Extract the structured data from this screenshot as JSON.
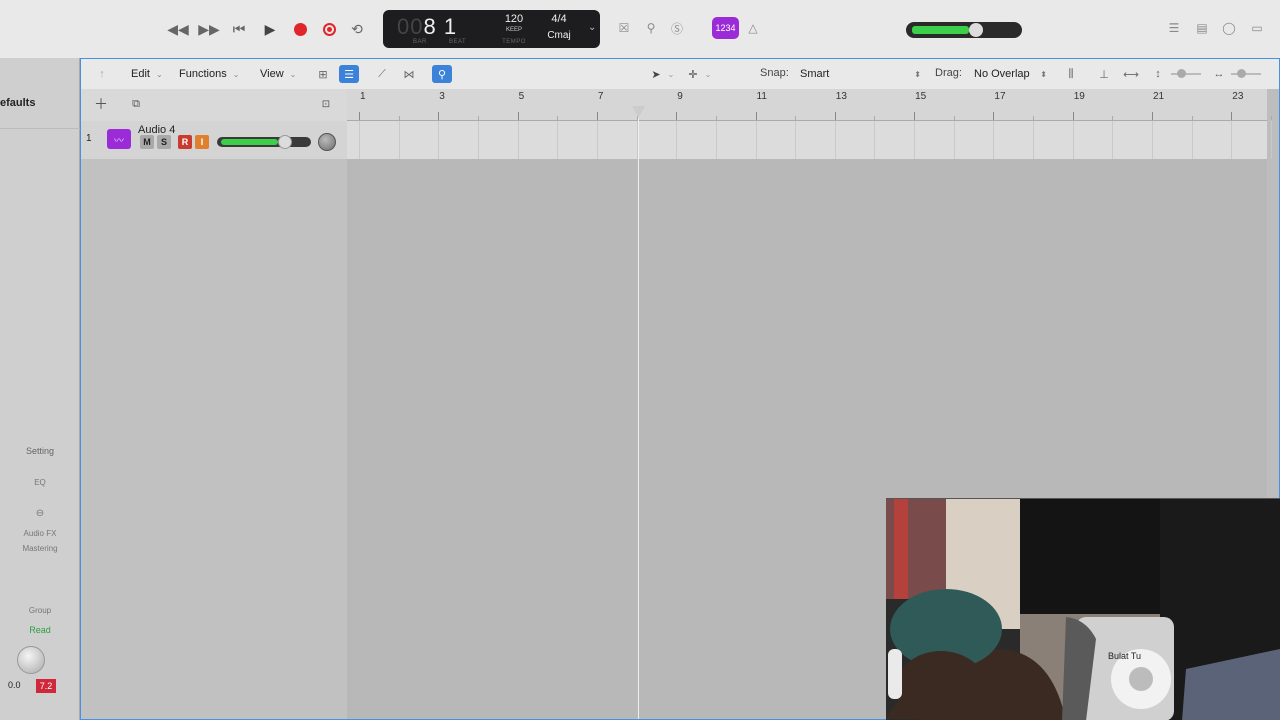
{
  "control_bar": {
    "lcd": {
      "bar_dim": "00",
      "bar": "8",
      "beat": "1",
      "bar_caption": "BAR",
      "beat_caption": "BEAT",
      "tempo": "120",
      "tempo_mode": "KEEP",
      "tempo_caption": "TEMPO",
      "time_signature": "4/4",
      "key": "Cmaj"
    },
    "count_in_badge": "1234",
    "master_volume_level": 0.55
  },
  "inspector": {
    "region_label_fragment": "efaults",
    "setting_button": "Setting",
    "eq_button": "EQ",
    "audio_fx": "Audio FX",
    "fx_slot": "Mastering",
    "group": "Group",
    "automation": "Read",
    "value_left": "0.0",
    "value_right": "7.2"
  },
  "toolbar": {
    "edit_menu": "Edit",
    "functions_menu": "Functions",
    "view_menu": "View",
    "snap_label": "Snap:",
    "snap_value": "Smart",
    "drag_label": "Drag:",
    "drag_value": "No Overlap"
  },
  "ruler": {
    "labels": [
      "1",
      "3",
      "5",
      "7",
      "9",
      "11",
      "13",
      "15",
      "17",
      "19",
      "21",
      "23"
    ]
  },
  "tracks": [
    {
      "number": "1",
      "name": "Audio 4",
      "mute": "M",
      "solo": "S",
      "record": "R",
      "input": "I",
      "volume_level": 0.8
    }
  ],
  "colors": {
    "accent_blue": "#3b82d8",
    "record_red": "#e0262b",
    "track_purple": "#9b2bd6",
    "meter_green": "#3ccf4a"
  },
  "webcam_overlay_text": "Bulat Tu"
}
